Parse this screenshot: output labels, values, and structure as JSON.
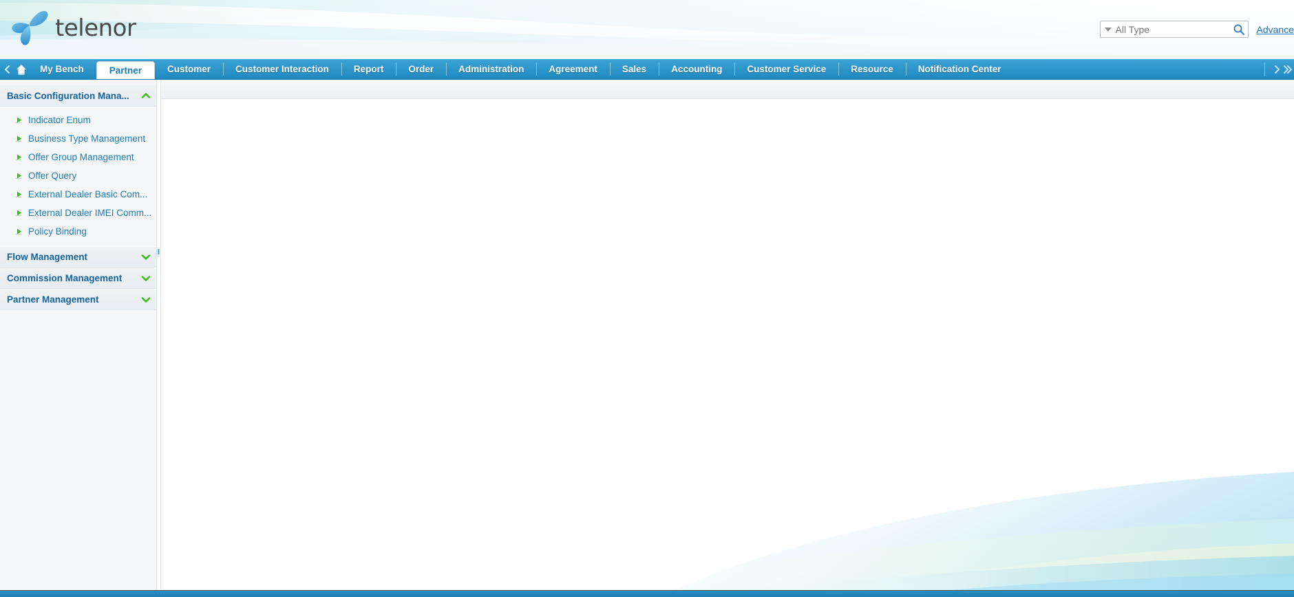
{
  "brand": {
    "name": "telenor",
    "logo_icon": "telenor-propeller-icon",
    "accent_blue": "#2089bf",
    "link_blue": "#1f6fb4",
    "sidebar_heading_blue": "#16629c",
    "bullet_green": "#3cbb1f"
  },
  "header": {
    "search": {
      "type_filter_label": "All Type",
      "placeholder": "All Type",
      "value": "",
      "search_icon": "magnifier-icon",
      "dropdown_icon": "caret-down-icon"
    },
    "advance_link": "Advance"
  },
  "nav": {
    "back_icon": "chevron-left-icon",
    "home_icon": "home-icon",
    "forward_icon": "chevron-right-icon",
    "more_icon": "chevron-double-right-icon",
    "active_tab": "Partner",
    "tabs": [
      {
        "label": "My Bench",
        "active": false
      },
      {
        "label": "Partner",
        "active": true
      },
      {
        "label": "Customer",
        "active": false
      },
      {
        "label": "Customer Interaction",
        "active": false
      },
      {
        "label": "Report",
        "active": false
      },
      {
        "label": "Order",
        "active": false
      },
      {
        "label": "Administration",
        "active": false
      },
      {
        "label": "Agreement",
        "active": false
      },
      {
        "label": "Sales",
        "active": false
      },
      {
        "label": "Accounting",
        "active": false
      },
      {
        "label": "Customer Service",
        "active": false
      },
      {
        "label": "Resource",
        "active": false
      },
      {
        "label": "Notification Center",
        "active": false
      }
    ]
  },
  "sidebar": {
    "sections": [
      {
        "title": "Basic Configuration Mana...",
        "expanded": true,
        "toggle_icon": "chevron-up-icon",
        "items": [
          {
            "label": "Indicator Enum",
            "icon": "green-arrow-bullet-icon"
          },
          {
            "label": "Business Type Management",
            "icon": "green-arrow-bullet-icon"
          },
          {
            "label": "Offer Group Management",
            "icon": "green-arrow-bullet-icon"
          },
          {
            "label": "Offer Query",
            "icon": "green-arrow-bullet-icon"
          },
          {
            "label": "External Dealer Basic Com...",
            "icon": "green-arrow-bullet-icon"
          },
          {
            "label": "External Dealer IMEI Comm...",
            "icon": "green-arrow-bullet-icon"
          },
          {
            "label": "Policy Binding",
            "icon": "green-arrow-bullet-icon"
          }
        ]
      },
      {
        "title": "Flow Management",
        "expanded": false,
        "toggle_icon": "chevron-down-icon",
        "items": []
      },
      {
        "title": "Commission Management",
        "expanded": false,
        "toggle_icon": "chevron-down-icon",
        "items": []
      },
      {
        "title": "Partner Management",
        "expanded": false,
        "toggle_icon": "chevron-down-icon",
        "items": []
      }
    ]
  },
  "main": {
    "content": ""
  }
}
